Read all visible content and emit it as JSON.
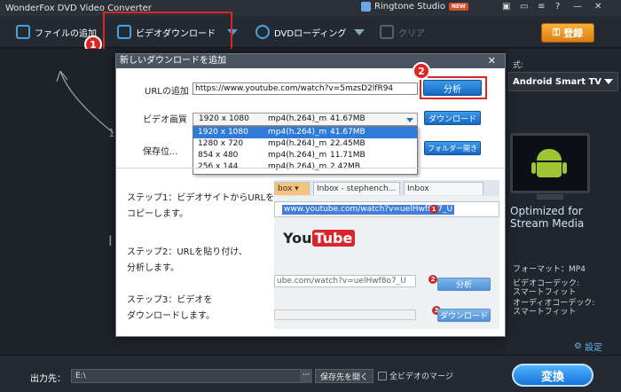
{
  "window": {
    "title": "WonderFox DVD Video Converter",
    "ringtone": "Ringtone Studio",
    "new_badge": "NEW"
  },
  "toolbar": {
    "add_file": "ファイルの追加",
    "video_download": "ビデオダウンロード",
    "dvd_loading": "DVDローディング",
    "clear": "クリア",
    "register": "登録"
  },
  "annotations": {
    "badge1": "1",
    "badge2": "2",
    "badge3": "3"
  },
  "dialog": {
    "title": "新しいダウンロードを追加",
    "close": "✕",
    "url_label": "URLの追加",
    "url_value": "https://www.youtube.com/watch?v=5mzsD2lfR94",
    "analyze": "分析",
    "quality_label": "ビデオ画質",
    "quality_selected": {
      "res": "1920 x 1080",
      "codec": "mp4(h.264)_m",
      "size": "41.67MB"
    },
    "download": "ダウンロード",
    "save_label": "保存位...",
    "open_folder": "フォルダー開き",
    "options": [
      {
        "res": "1920 x 1080",
        "codec": "mp4(h.264)_m",
        "size": "41.67MB"
      },
      {
        "res": "1280 x 720",
        "codec": "mp4(h.264)_m",
        "size": "22.45MB"
      },
      {
        "res": "854 x 480",
        "codec": "mp4(h.264)_m",
        "size": "11.71MB"
      },
      {
        "res": "256 x 144",
        "codec": "mp4(h.264)_m",
        "size": "2.42MB"
      }
    ],
    "steps": {
      "s1a": "ステップ1：ビデオサイトからURLを",
      "s1b": "コピーします。",
      "s2a": "ステップ2：URLを貼り付け、",
      "s2b": "分析します。",
      "s3a": "ステップ3：ビデオを",
      "s3b": "ダウンロードします。"
    },
    "demo": {
      "tab1": "box ▾",
      "tab2": "Inbox - stephench...",
      "tab3": "Inbox",
      "url": "www.youtube.com/watch?v=uelHwf8o7_U",
      "you": "You",
      "tube": "Tube",
      "url2": "ube.com/watch?v=uelHwf8o7_U",
      "analyze": "分析",
      "download": "ダウンロード"
    }
  },
  "right": {
    "format_label": "式:",
    "format_value": "Android Smart TV",
    "optimized": "Optimized for Stream Media",
    "format_line": "フォーマット：MP4",
    "vcodec": "ビデオコーデック:",
    "vcodec_val": "スマートフィット",
    "acodec": "オーディオコーデック:",
    "acodec_val": "スマートフィット",
    "setting": "設定"
  },
  "main": {
    "digit_one": "1",
    "letter_i": "I"
  },
  "bottom": {
    "output_label": "出力先：",
    "output_path": "E:\\",
    "dots": "···",
    "open_folder": "保存先を開く",
    "merge": "全ビデオのマージ",
    "convert": "変換"
  }
}
